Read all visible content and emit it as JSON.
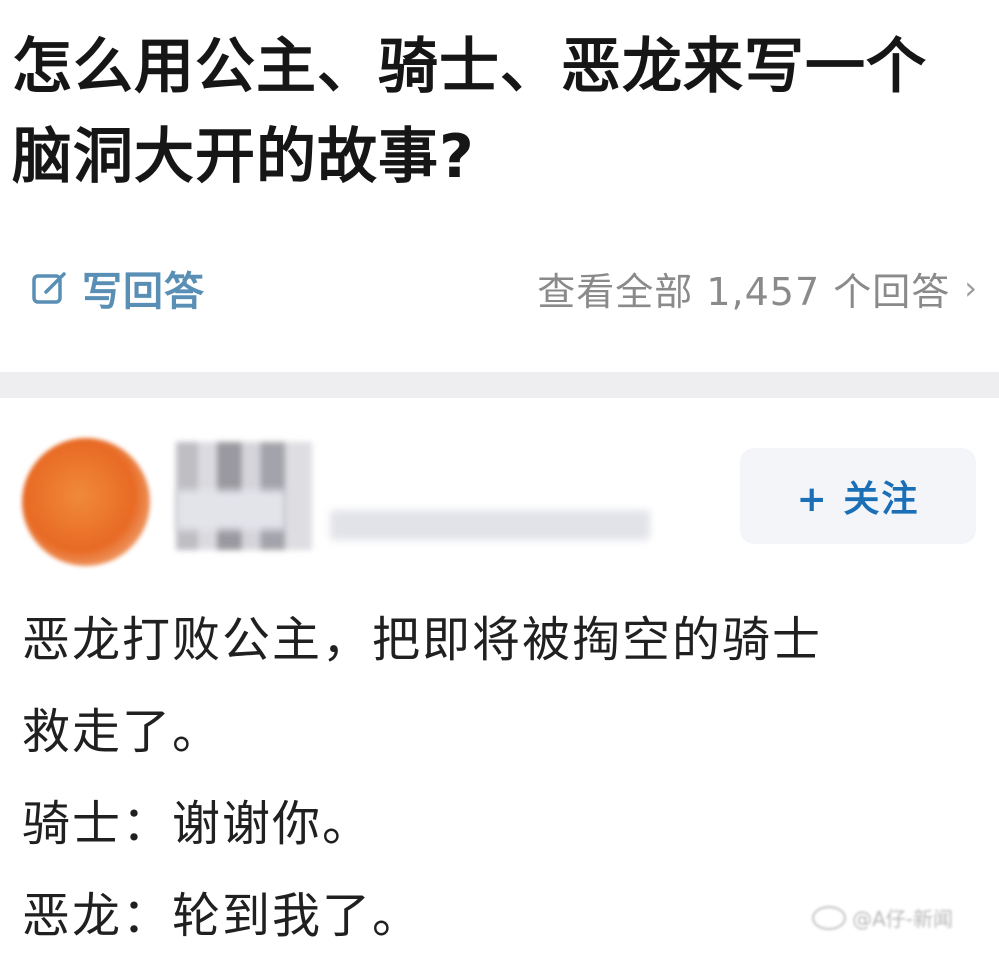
{
  "question": {
    "title": "怎么用公主、骑士、恶龙来写一个脑洞大开的故事?"
  },
  "actions": {
    "write_answer_label": "写回答",
    "write_answer_icon": "edit-icon",
    "view_all_label": "查看全部 1,457 个回答",
    "view_all_chevron": "›"
  },
  "answer": {
    "follow_label": "+ 关注",
    "lines": [
      "恶龙打败公主，把即将被掏空的骑士",
      "救走了。",
      "骑士：谢谢你。",
      "恶龙：轮到我了。"
    ]
  },
  "watermark": {
    "text": "@A仔-新闻"
  },
  "colors": {
    "accent": "#1a6fb7",
    "write_answer": "#5a8fb5",
    "secondary_text": "#8a8a8a",
    "divider": "#eeeef1"
  }
}
